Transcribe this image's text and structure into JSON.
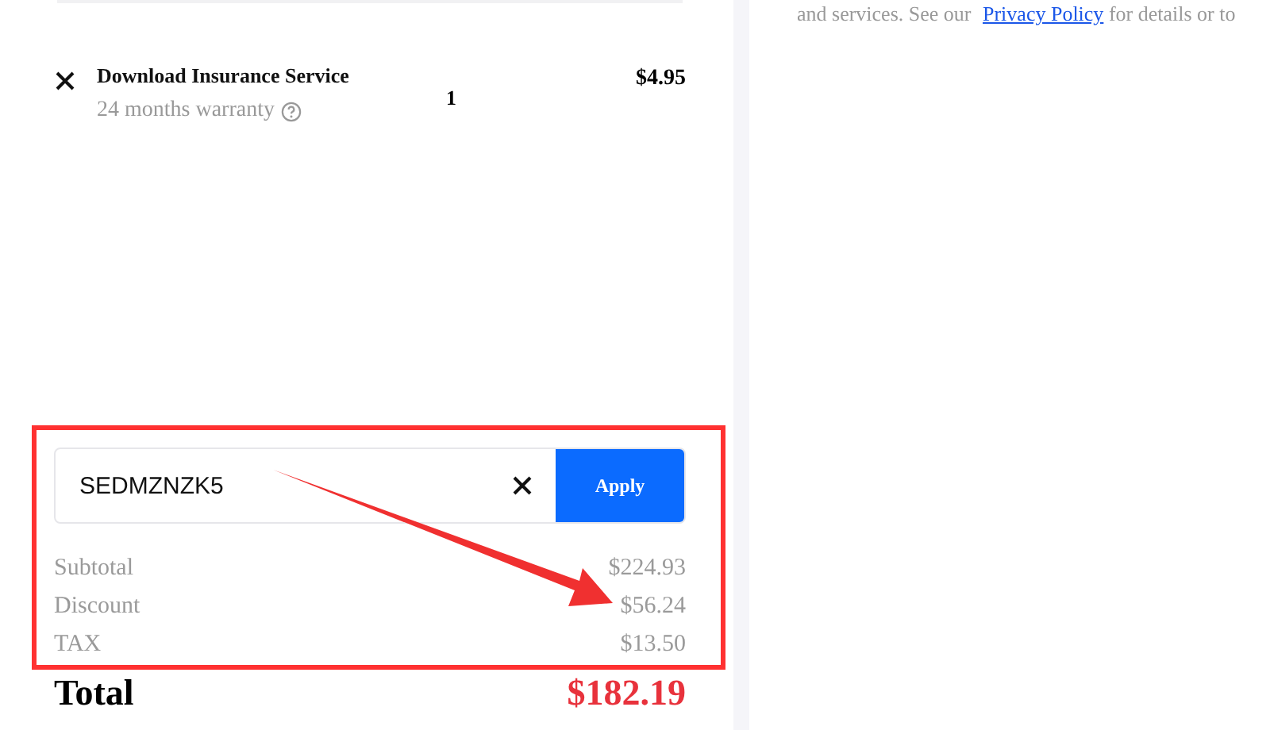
{
  "cart_item": {
    "name": "Download Insurance Service",
    "note": "24 months warranty",
    "quantity": "1",
    "price": "$4.95"
  },
  "coupon": {
    "value": "SEDMZNZK5",
    "button": "Apply"
  },
  "summary": [
    {
      "label": "Subtotal",
      "amount": "$224.93"
    },
    {
      "label": "Discount",
      "amount": "$56.24"
    },
    {
      "label": "TAX",
      "amount": "$13.50"
    }
  ],
  "total": {
    "label": "Total",
    "amount": "$182.19"
  },
  "privacy_text": {
    "before": "and services. See our ",
    "link": "Privacy Policy",
    "after": " for details or to"
  }
}
